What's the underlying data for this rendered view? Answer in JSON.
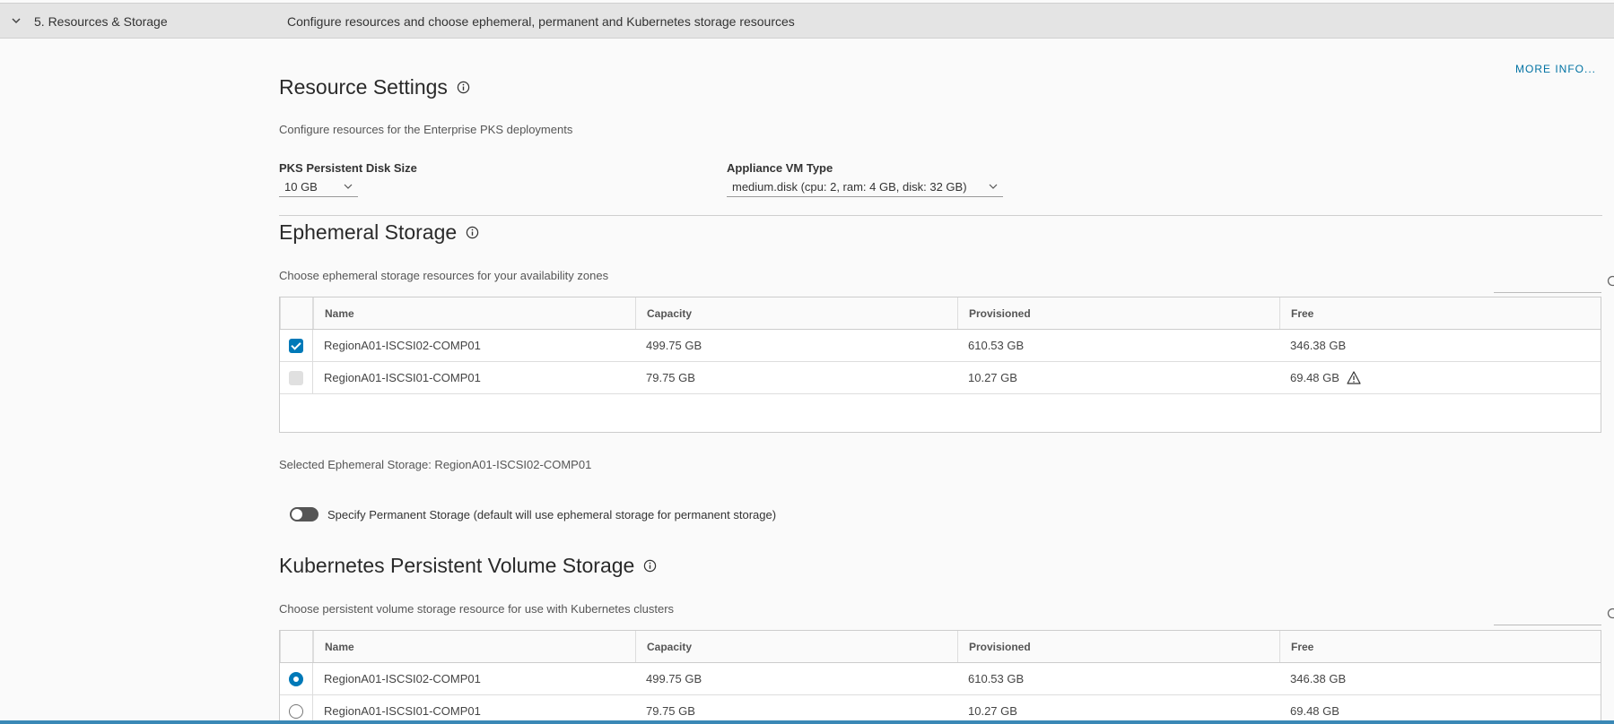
{
  "section": {
    "title": "5. Resources & Storage",
    "description": "Configure resources and choose ephemeral, permanent and Kubernetes storage resources"
  },
  "more_info": "MORE INFO...",
  "resource_settings": {
    "heading": "Resource Settings",
    "description": "Configure resources for the Enterprise PKS deployments",
    "disk_size_label": "PKS Persistent Disk Size",
    "disk_size_value": "10 GB",
    "vm_type_label": "Appliance VM Type",
    "vm_type_value": "medium.disk (cpu: 2, ram: 4 GB, disk: 32 GB)"
  },
  "ephemeral": {
    "heading": "Ephemeral Storage",
    "description": "Choose ephemeral storage resources for your availability zones",
    "columns": [
      "Name",
      "Capacity",
      "Provisioned",
      "Free"
    ],
    "rows": [
      {
        "name": "RegionA01-ISCSI02-COMP01",
        "capacity": "499.75 GB",
        "provisioned": "610.53 GB",
        "free": "346.38 GB",
        "selected": true,
        "warning": false
      },
      {
        "name": "RegionA01-ISCSI01-COMP01",
        "capacity": "79.75 GB",
        "provisioned": "10.27 GB",
        "free": "69.48 GB",
        "selected": false,
        "warning": true
      }
    ],
    "selected_text": "Selected Ephemeral Storage: RegionA01-ISCSI02-COMP01"
  },
  "permanent_toggle": {
    "label": "Specify Permanent Storage (default will use ephemeral storage for permanent storage)",
    "on": false
  },
  "kubernetes": {
    "heading": "Kubernetes Persistent Volume Storage",
    "description": "Choose persistent volume storage resource for use with Kubernetes clusters",
    "columns": [
      "Name",
      "Capacity",
      "Provisioned",
      "Free"
    ],
    "rows": [
      {
        "name": "RegionA01-ISCSI02-COMP01",
        "capacity": "499.75 GB",
        "provisioned": "610.53 GB",
        "free": "346.38 GB",
        "selected": true
      },
      {
        "name": "RegionA01-ISCSI01-COMP01",
        "capacity": "79.75 GB",
        "provisioned": "10.27 GB",
        "free": "69.48 GB",
        "selected": false
      }
    ]
  },
  "colors": {
    "accent": "#0079b8",
    "link": "#0072a3",
    "header_bg": "#e4e4e4"
  }
}
